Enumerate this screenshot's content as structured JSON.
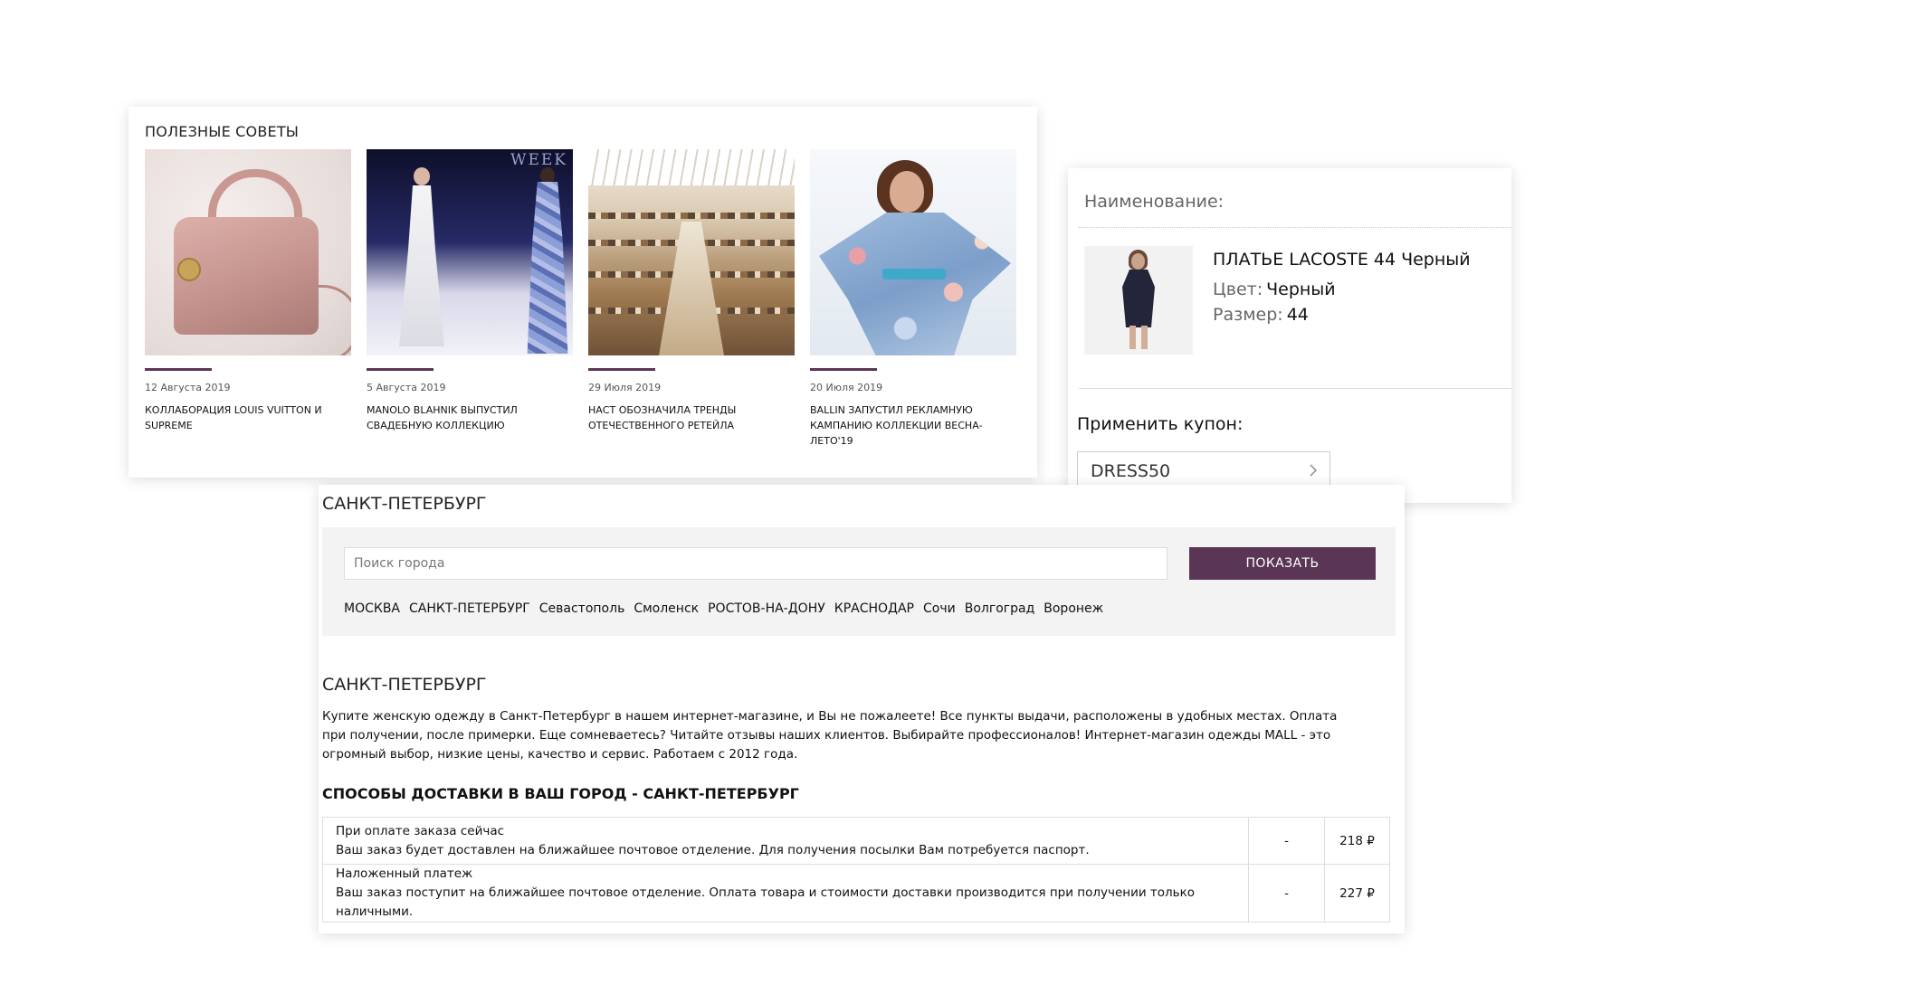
{
  "tips": {
    "title": "ПОЛЕЗНЫЕ СОВЕТЫ",
    "articles": [
      {
        "date": "12 Августа 2019",
        "headline": "КОЛЛАБОРАЦИЯ LOUIS VUITTON И SUPREME"
      },
      {
        "date": "5 Августа 2019",
        "headline": "MANOLO BLAHNIK ВЫПУСТИЛ СВАДЕБНУЮ КОЛЛЕКЦИЮ"
      },
      {
        "date": "29 Июля 2019",
        "headline": "НАСТ ОБОЗНАЧИЛА ТРЕНДЫ ОТЕЧЕСТВЕННОГО РЕТЕЙЛА"
      },
      {
        "date": "20 Июля 2019",
        "headline": "BALLIN ЗАПУСТИЛ РЕКЛАМНУЮ КАМПАНИЮ КОЛЛЕКЦИИ ВЕСНА-ЛЕТО'19"
      }
    ],
    "accent_color": "#5a3556"
  },
  "product": {
    "label": "Наименование:",
    "name": "ПЛАТЬЕ LACOSTE 44 Черный",
    "color_label": "Цвет:",
    "color_value": "Черный",
    "size_label": "Размер:",
    "size_value": "44",
    "coupon_label": "Применить купон:",
    "coupon_value": "DRESS50"
  },
  "city": {
    "heading": "САНКТ-ПЕТЕРБУРГ",
    "search_placeholder": "Поиск города",
    "show_button": "ПОКАЗАТЬ",
    "button_color": "#5a3556",
    "links": [
      "МОСКВА",
      "САНКТ-ПЕТЕРБУРГ",
      "Севастополь",
      "Смоленск",
      "РОСТОВ-НА-ДОНУ",
      "КРАСНОДАР",
      "Сочи",
      "Волгоград",
      "Воронеж"
    ]
  },
  "seo": {
    "heading": "САНКТ-ПЕТЕРБУРГ",
    "text": "Купите женскую одежду в Санкт-Петербург в нашем интернет-магазине, и Вы не пожалеете! Все пункты выдачи, расположены в удобных местах. Оплата при получении, после примерки. Еще сомневаетесь? Читайте отзывы наших клиентов. Выбирайте профессионалов! Интернет-магазин одежды MALL - это огромный выбор, низкие цены, качество и сервис. Работаем с 2012 года."
  },
  "delivery": {
    "heading": "СПОСОБЫ ДОСТАВКИ В ВАШ ГОРОД - САНКТ-ПЕТЕРБУРГ",
    "rows": [
      {
        "title": "При оплате заказа сейчас",
        "description": "Ваш заказ будет доставлен на ближайшее почтовое отделение. Для получения посылки Вам потребуется паспорт.",
        "term": "-",
        "price": "218 ₽"
      },
      {
        "title": "Наложенный платеж",
        "description": "Ваш заказ поступит на ближайшее почтовое отделение. Оплата товара и стоимости доставки производится при получении только наличными.",
        "term": "-",
        "price": "227 ₽"
      }
    ]
  }
}
